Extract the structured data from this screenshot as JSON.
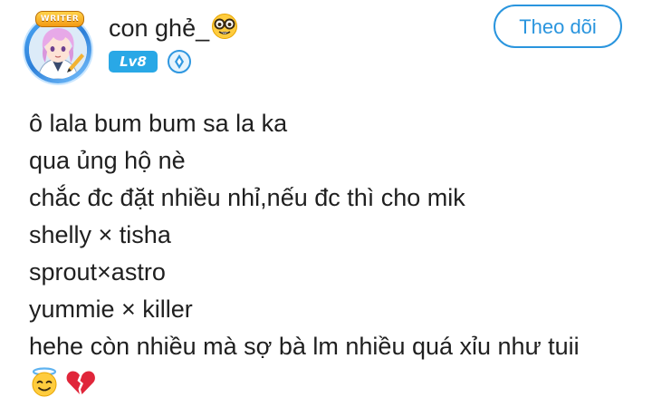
{
  "user": {
    "name": "con ghẻ_",
    "name_emoji": "nerd-face-icon",
    "avatar_badge": "WRITER",
    "level": "Lv8",
    "verify_icon": "verified-shield-icon"
  },
  "actions": {
    "follow_label": "Theo dõi"
  },
  "post": {
    "lines": [
      "ô lala bum bum sa la ka",
      "qua ủng hộ nè",
      "chắc đc đặt nhiều nhỉ,nếu đc thì cho mik",
      "shelly × tisha",
      "sprout×astro",
      "yummie × killer",
      "hehe còn nhiều mà sợ bà lm nhiều quá xỉu như tuii"
    ],
    "emojis": [
      "smiling-face-with-halo-icon",
      "broken-heart-icon"
    ]
  },
  "colors": {
    "accent": "#2a95de",
    "level_badge": "#29a8e6",
    "text": "#1f1f1f"
  }
}
